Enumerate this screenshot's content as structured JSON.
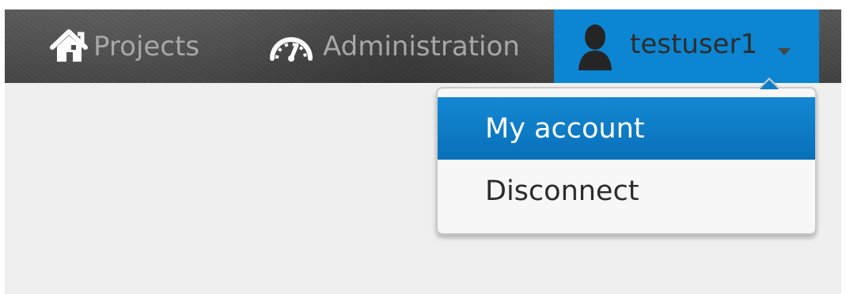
{
  "navbar": {
    "items": [
      {
        "label": "Projects",
        "icon": "home-icon"
      },
      {
        "label": "Administration",
        "icon": "gauge-icon"
      }
    ],
    "user": {
      "name": "testuser1",
      "icon": "user-icon",
      "caret_icon": "caret-down-icon"
    }
  },
  "dropdown": {
    "items": [
      {
        "label": "My account",
        "active": true
      },
      {
        "label": "Disconnect",
        "active": false
      }
    ]
  },
  "colors": {
    "nav_background": "#454545",
    "nav_text": "#a7a7a7",
    "accent": "#0c86d2",
    "menu_background": "#f7f7f7",
    "page_background": "#efefef"
  }
}
